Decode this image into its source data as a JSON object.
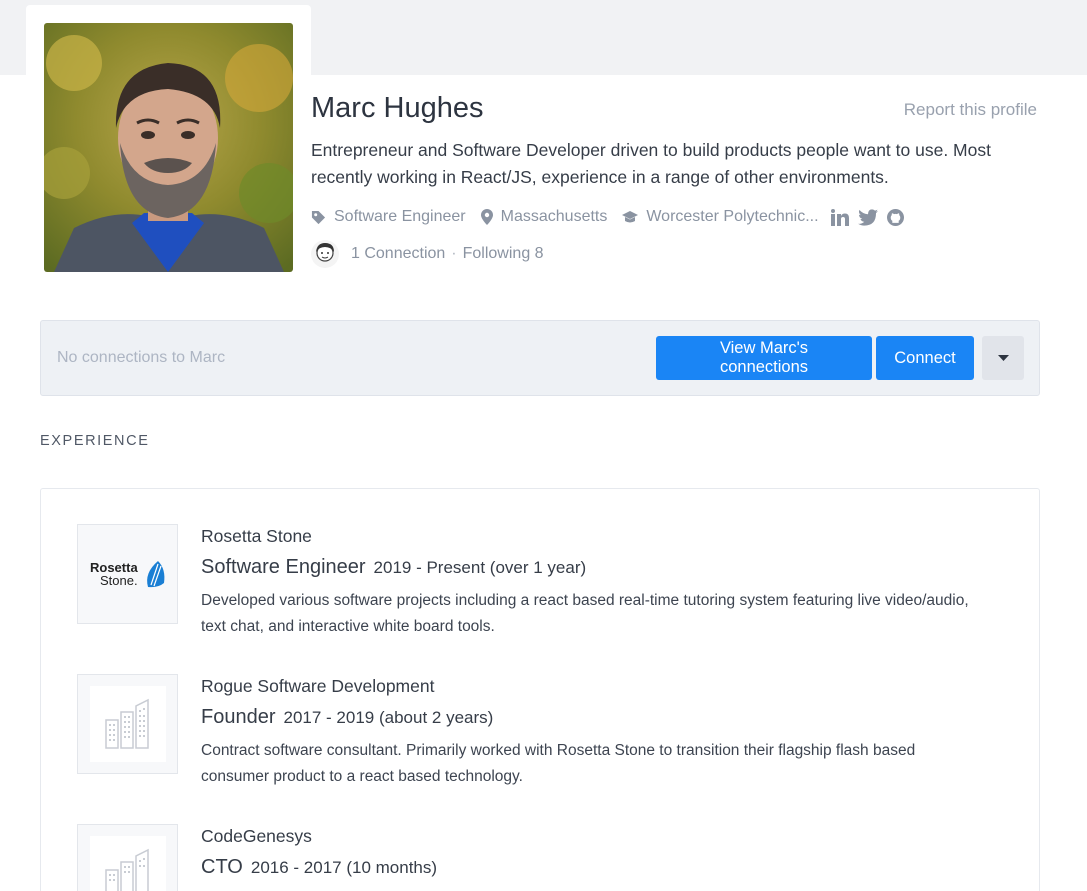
{
  "profile": {
    "name": "Marc Hughes",
    "report_link": "Report this profile",
    "bio": "Entrepreneur and Software Developer driven to build products people want to use. Most recently working in React/JS, experience in a range of other environments.",
    "job_title": "Software Engineer",
    "location": "Massachusetts",
    "school": "Worcester Polytechnic...",
    "social_icons": [
      "linkedin-icon",
      "twitter-icon",
      "github-icon"
    ],
    "connections_count": "1 Connection",
    "separator": "·",
    "following": "Following 8"
  },
  "connections_panel": {
    "empty_text": "No connections to Marc",
    "view_button": "View Marc's connections",
    "connect_button": "Connect",
    "menu_icon": "caret-down-icon"
  },
  "experience": {
    "section_title": "EXPERIENCE",
    "items": [
      {
        "company": "Rosetta Stone",
        "logo_text_line1": "Rosetta",
        "logo_text_line2": "Stone.",
        "role": "Software Engineer",
        "dates": "2019 - Present (over 1 year)",
        "description": "Developed various software projects including a react based real-time tutoring system featuring live video/audio, text chat, and interactive white board tools."
      },
      {
        "company": "Rogue Software Development",
        "role": "Founder",
        "dates": "2017 - 2019 (about 2 years)",
        "description": "Contract software consultant. Primarily worked with Rosetta Stone to transition their flagship flash based consumer product to a react based technology."
      },
      {
        "company": "CodeGenesys",
        "role": "CTO",
        "dates": "2016 - 2017 (10 months)",
        "description": ""
      }
    ]
  },
  "colors": {
    "primary": "#1a85f5",
    "muted_text": "#8a93a1",
    "panel_bg": "#eef1f5",
    "rosetta_blue": "#1a7fd4"
  }
}
